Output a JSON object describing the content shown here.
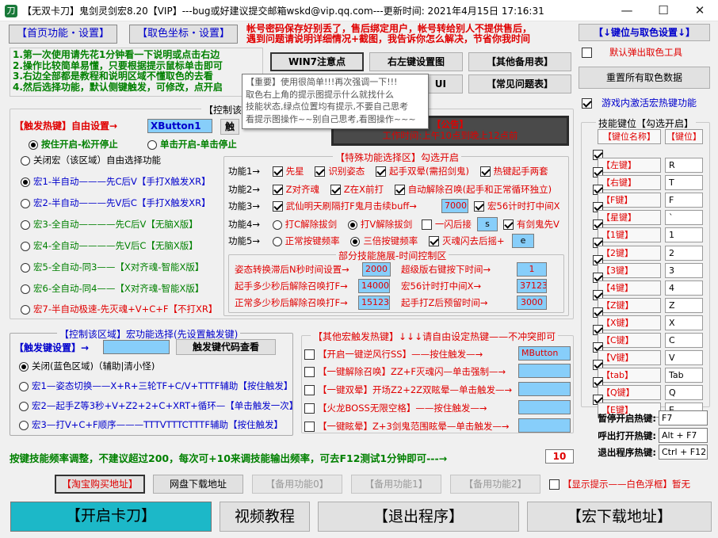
{
  "window": {
    "title": "【无双卡刀】鬼剑灵剑宏8.20【VIP】---bug或好建议提交邮箱wskd@vip.qq.com---更新时间: 2021年4月15日 17:16:31",
    "minimize": "—",
    "maximize": "☐",
    "close": "✕"
  },
  "tabs": {
    "home": "【首页功能・设置】",
    "color": "【取色坐标・设置】"
  },
  "notice_top": {
    "line1": "帐号密码保存好别丢了，售后绑定用户，帐号转给别人不提供售后，",
    "line2": "遇到问题请说明详细情况+截图，我告诉你怎么解决，节省你我时间"
  },
  "right_top_btn": "【↓键位与取色设置↓】",
  "default_popup": "默认弹出取色工具",
  "reset_colors": "重置所有取色数据",
  "activate_hotkey": "游戏内激活宏热键功能",
  "instructions": [
    "1.第一次使用请先花1分钟看一下说明或点击右边",
    "2.操作比较简单易懂，只要根据提示鼠标单击即可",
    "3.右边全部都是教程和说明区域不懂取色的去看",
    "4.然后选择功能，默认侧键触发，可修改，点开启"
  ],
  "mid_btns": {
    "win7": "WIN7注意点",
    "mouse": "右左键设置图",
    "other": "【其他备用表】",
    "ui": "UI",
    "faq": "【常见问题表】"
  },
  "tooltip": {
    "line1": "【重要】使用很简单!!!再次强调一下!!!",
    "line2": "取色右上角的提示图提示什么就找什么",
    "line3": "技能状态,绿点位置均有提示,不要自己思考",
    "line4": "看提示图操作~~别自己思考,看图操作~~~"
  },
  "control_group": {
    "title": "【控制该",
    "trigger_label": "【触发热键】自由设置→",
    "trigger_value": "XButton1",
    "trigger_btn": "触",
    "mode_hold": "按住开启-松开停止",
    "mode_click": "单击开启-单击停止"
  },
  "macros": [
    {
      "label": "关闭宏（该区域）自由选择功能",
      "style": "plain"
    },
    {
      "label": "宏1-半自动———先C后V【手打X触发XR】",
      "style": "blue",
      "on": true
    },
    {
      "label": "宏2-半自动———先V后C【手打X触发XR】",
      "style": "blue"
    },
    {
      "label": "宏3-全自动————先C后V【无脑X版】",
      "style": "green"
    },
    {
      "label": "宏4-全自动————先V后C【无脑X版】",
      "style": "green"
    },
    {
      "label": "宏5-全自动-同3——【X对齐魂-智能X版】",
      "style": "green"
    },
    {
      "label": "宏6-全自动-同4——【X对齐魂-智能X版】",
      "style": "green"
    },
    {
      "label": "宏7-半自动极速-先灭魂+V+C+F【不打XR】",
      "style": "red"
    }
  ],
  "announce": {
    "title": "【公告】",
    "text": "工作时间:上午10点到晚上12点前"
  },
  "special": {
    "title": "【特殊功能选择区】勾选开启",
    "row1": {
      "label": "功能1→",
      "items": [
        "先星",
        "识别姿态",
        "起手双晕(需招剑鬼)",
        "热键起手两套"
      ]
    },
    "row2": {
      "label": "功能2→",
      "items": [
        "Z对齐魂",
        "Z在X前打",
        "自动解除召唤(起手和正常循环独立)"
      ]
    },
    "row3": {
      "label": "功能3→",
      "a": "武仙明天刷隔打F鬼月击续buff→",
      "a_val": "7000",
      "b": "宏56计时打中间X"
    },
    "row4": {
      "label": "功能4→",
      "a": "打C解除拔剑",
      "b": "打V解除拔剑",
      "c": "一闪后接",
      "c_val": "s",
      "d": "有剑鬼先V"
    },
    "row5": {
      "label": "功能5→",
      "a": "正常按键频率",
      "b": "三倍按键频率",
      "c": "灭魂闪去后摇+",
      "c_val": "e"
    }
  },
  "timing": {
    "title": "部分技能施展-时间控制区",
    "items": [
      {
        "label": "姿态转换滞后N秒时间设置→",
        "value": "2000"
      },
      {
        "label": "超级版右键按下时间→",
        "value": "1"
      },
      {
        "label": "起手多少秒后解除召唤打F→",
        "value": "14000"
      },
      {
        "label": "宏56计时打中间X→",
        "value": "37123"
      },
      {
        "label": "正常多少秒后解除召唤打F→",
        "value": "15123"
      },
      {
        "label": "起手打Z后预留时间→",
        "value": "3000"
      }
    ]
  },
  "control2": {
    "title": "【控制该区域】宏功能选择(先设置触发键)",
    "trigger_label": "【触发键设置】→",
    "code_btn": "触发键代码查看",
    "options": [
      {
        "label": "关闭(蓝色区域)（辅助|清小怪)",
        "on": true
      },
      {
        "label": "宏1—姿态切换——X+R+三轮TF+C/V+TTTF辅助【按住触发】"
      },
      {
        "label": "宏2—起手Z等3秒+V+Z2+2+C+XRT+循环—【单击触发一次】"
      },
      {
        "label": "宏3—打V+C+F顺序———TTTVTTTCTTTF辅助【按住触发】"
      }
    ]
  },
  "other_hotkeys": {
    "title": "【其他宏触发热键】↓↓↓请自由设定热键——不冲突即可",
    "items": [
      {
        "label": "【开启一键逆风行SS】——按住触发—→",
        "value": "MButton"
      },
      {
        "label": "【一键解除召唤】ZZ+F灭魂闪—单击强制—→",
        "value": ""
      },
      {
        "label": "【一键双晕】开场Z2+2Z双眩晕—单击触发—→",
        "value": ""
      },
      {
        "label": "【火龙BOSS无限空格】——按住触发—→",
        "value": ""
      },
      {
        "label": "【一键眩晕】Z+3剑鬼范围眩晕—单击触发—→",
        "value": ""
      }
    ]
  },
  "skills": {
    "title": "技能键位【勾选开启】",
    "col_name": "【键位名称】",
    "col_key": "【键位】",
    "rows": [
      {
        "name": "【左键】",
        "key": "R"
      },
      {
        "name": "【右键】",
        "key": "T"
      },
      {
        "name": "【F键】",
        "key": "F"
      },
      {
        "name": "【星键】",
        "key": "`"
      },
      {
        "name": "【1键】",
        "key": "1"
      },
      {
        "name": "【2键】",
        "key": "2"
      },
      {
        "name": "【3键】",
        "key": "3"
      },
      {
        "name": "【4键】",
        "key": "4"
      },
      {
        "name": "【Z键】",
        "key": "Z"
      },
      {
        "name": "【X键】",
        "key": "X"
      },
      {
        "name": "【C键】",
        "key": "C"
      },
      {
        "name": "【V键】",
        "key": "V"
      },
      {
        "name": "【tab】",
        "key": "Tab"
      },
      {
        "name": "【Q键】",
        "key": "Q"
      },
      {
        "name": "【E键】",
        "key": "E"
      }
    ]
  },
  "hotkeys": [
    {
      "label": "暂停开启热键:",
      "value": "F7"
    },
    {
      "label": "呼出打开热键:",
      "value": "Alt + F7"
    },
    {
      "label": "退出程序热键:",
      "value": "Ctrl + F12"
    }
  ],
  "frequency": {
    "text": "按键技能频率调整，不建议超过200，每次可+10来调技能输出频率，可去F12测试1分钟即可---→",
    "value": "10"
  },
  "bottom_small": {
    "taobao": "【淘宝购买地址】",
    "netdisk": "网盘下载地址",
    "spare0": "【备用功能0】",
    "spare1": "【备用功能1】",
    "spare2": "【备用功能2】",
    "show_tip": "【显示提示——白色浮框】暂无"
  },
  "bottom_big": {
    "start": "【开启卡刀】",
    "video": "视频教程",
    "exit": "【退出程序】",
    "download": "【宏下载地址】"
  }
}
